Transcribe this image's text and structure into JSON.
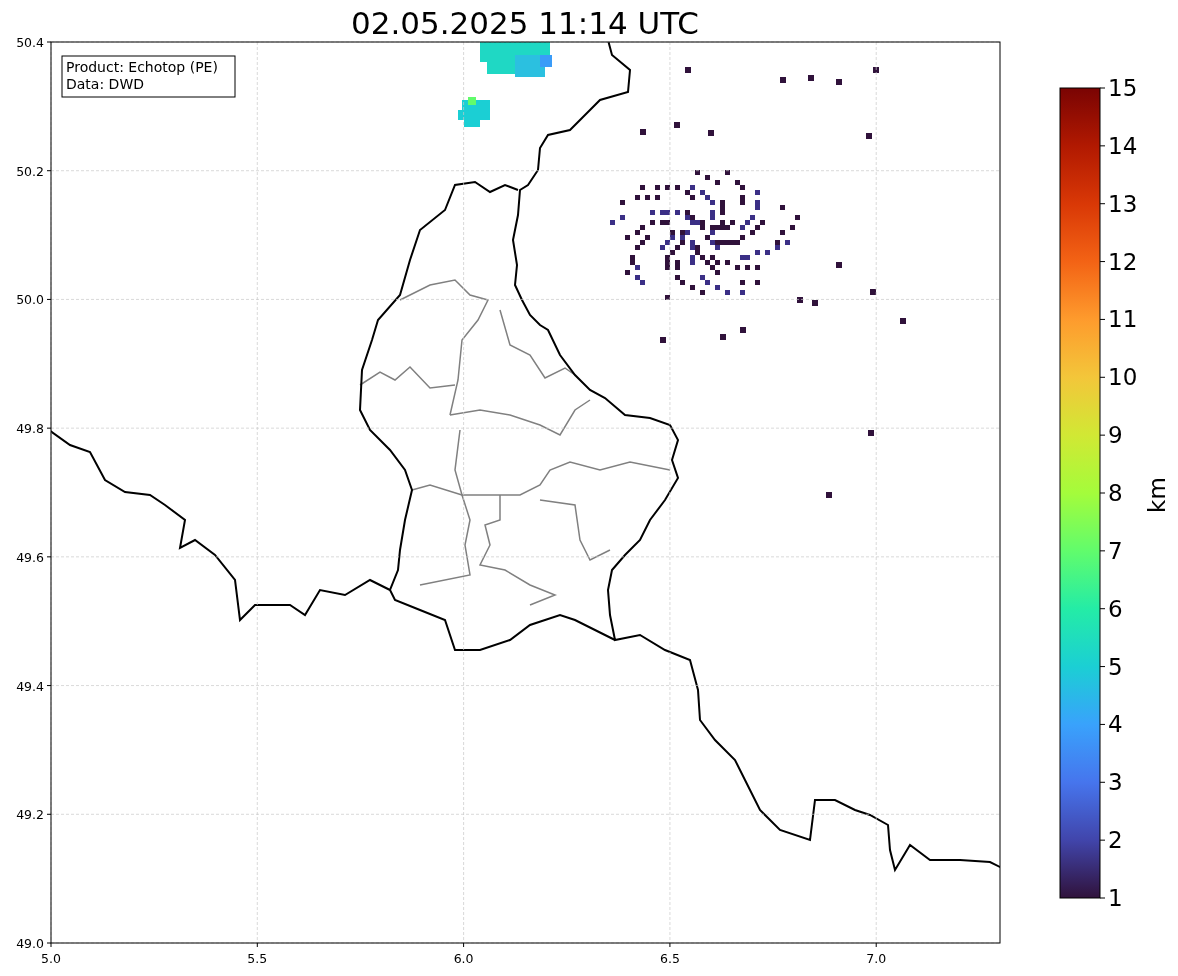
{
  "title": "02.05.2025 11:14 UTC",
  "info_box": {
    "lines": [
      "Product: Echotop (PE)",
      "Data: DWD"
    ]
  },
  "x_axis": {
    "ticks": [
      "5.0",
      "5.5",
      "6.0",
      "6.5",
      "7.0"
    ]
  },
  "y_axis": {
    "ticks": [
      "50.4",
      "50.2",
      "50.0",
      "49.8",
      "49.6",
      "49.4",
      "49.2",
      "49.0"
    ]
  },
  "colorbar": {
    "label": "km",
    "ticks": [
      "15",
      "14",
      "13",
      "12",
      "11",
      "10",
      "9",
      "8",
      "7",
      "6",
      "5",
      "4",
      "3",
      "2",
      "1"
    ]
  }
}
